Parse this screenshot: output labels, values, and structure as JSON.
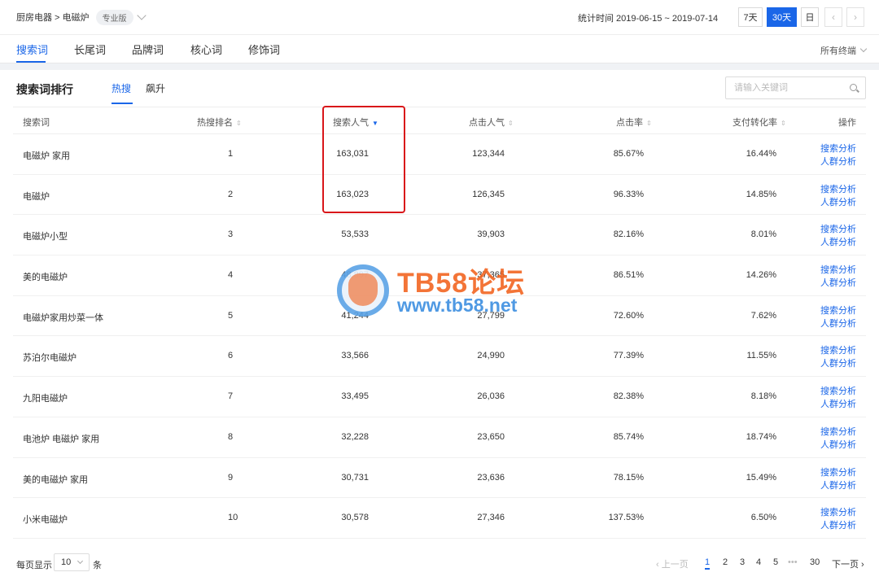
{
  "header": {
    "breadcrumb": "厨房电器 > 电磁炉",
    "edition_badge": "专业版",
    "period_label": "统计时间 2019-06-15 ~ 2019-07-14",
    "ranges": [
      "7天",
      "30天",
      "日"
    ],
    "active_range": "30天",
    "prev_symbol": "‹",
    "next_symbol": "›"
  },
  "tabs": [
    "搜索词",
    "长尾词",
    "品牌词",
    "核心词",
    "修饰词"
  ],
  "active_tab": "搜索词",
  "device_filter": "所有终端",
  "section": {
    "title": "搜索词排行",
    "subtabs": [
      "热搜",
      "飙升"
    ],
    "active_subtab": "热搜",
    "search_placeholder": "请输入关键词"
  },
  "table": {
    "columns": [
      "搜索词",
      "热搜排名",
      "搜索人气",
      "点击人气",
      "点击率",
      "支付转化率",
      "操作"
    ],
    "sorted_column": "搜索人气",
    "rows": [
      {
        "term": "电磁炉 家用",
        "rank": "1",
        "search": "163,031",
        "click": "123,344",
        "ctr": "85.67%",
        "conv": "16.44%"
      },
      {
        "term": "电磁炉",
        "rank": "2",
        "search": "163,023",
        "click": "126,345",
        "ctr": "96.33%",
        "conv": "14.85%"
      },
      {
        "term": "电磁炉小型",
        "rank": "3",
        "search": "53,533",
        "click": "39,903",
        "ctr": "82.16%",
        "conv": "8.01%"
      },
      {
        "term": "美的电磁炉",
        "rank": "4",
        "search": "48,897",
        "click": "37,365",
        "ctr": "86.51%",
        "conv": "14.26%"
      },
      {
        "term": "电磁炉家用炒菜一体",
        "rank": "5",
        "search": "41,244",
        "click": "27,799",
        "ctr": "72.60%",
        "conv": "7.62%"
      },
      {
        "term": "苏泊尔电磁炉",
        "rank": "6",
        "search": "33,566",
        "click": "24,990",
        "ctr": "77.39%",
        "conv": "11.55%"
      },
      {
        "term": "九阳电磁炉",
        "rank": "7",
        "search": "33,495",
        "click": "26,036",
        "ctr": "82.38%",
        "conv": "8.18%"
      },
      {
        "term": "电池炉 电磁炉 家用",
        "rank": "8",
        "search": "32,228",
        "click": "23,650",
        "ctr": "85.74%",
        "conv": "18.74%"
      },
      {
        "term": "美的电磁炉 家用",
        "rank": "9",
        "search": "30,731",
        "click": "23,636",
        "ctr": "78.15%",
        "conv": "15.49%"
      },
      {
        "term": "小米电磁炉",
        "rank": "10",
        "search": "30,578",
        "click": "27,346",
        "ctr": "137.53%",
        "conv": "6.50%"
      }
    ],
    "action_links": [
      "搜索分析",
      "人群分析"
    ]
  },
  "watermark": {
    "title": "TB58论坛",
    "url": "www.tb58.net"
  },
  "pagination": {
    "per_page_label": "每页显示",
    "per_page_value": "10",
    "per_page_unit": "条",
    "prev": "‹ 上一页",
    "pages": [
      "1",
      "2",
      "3",
      "4",
      "5"
    ],
    "ellipsis": "•••",
    "last": "30",
    "next": "下一页 ›",
    "current": "1"
  },
  "colors": {
    "accent": "#1a66e8",
    "highlight_border": "#d9161a"
  }
}
